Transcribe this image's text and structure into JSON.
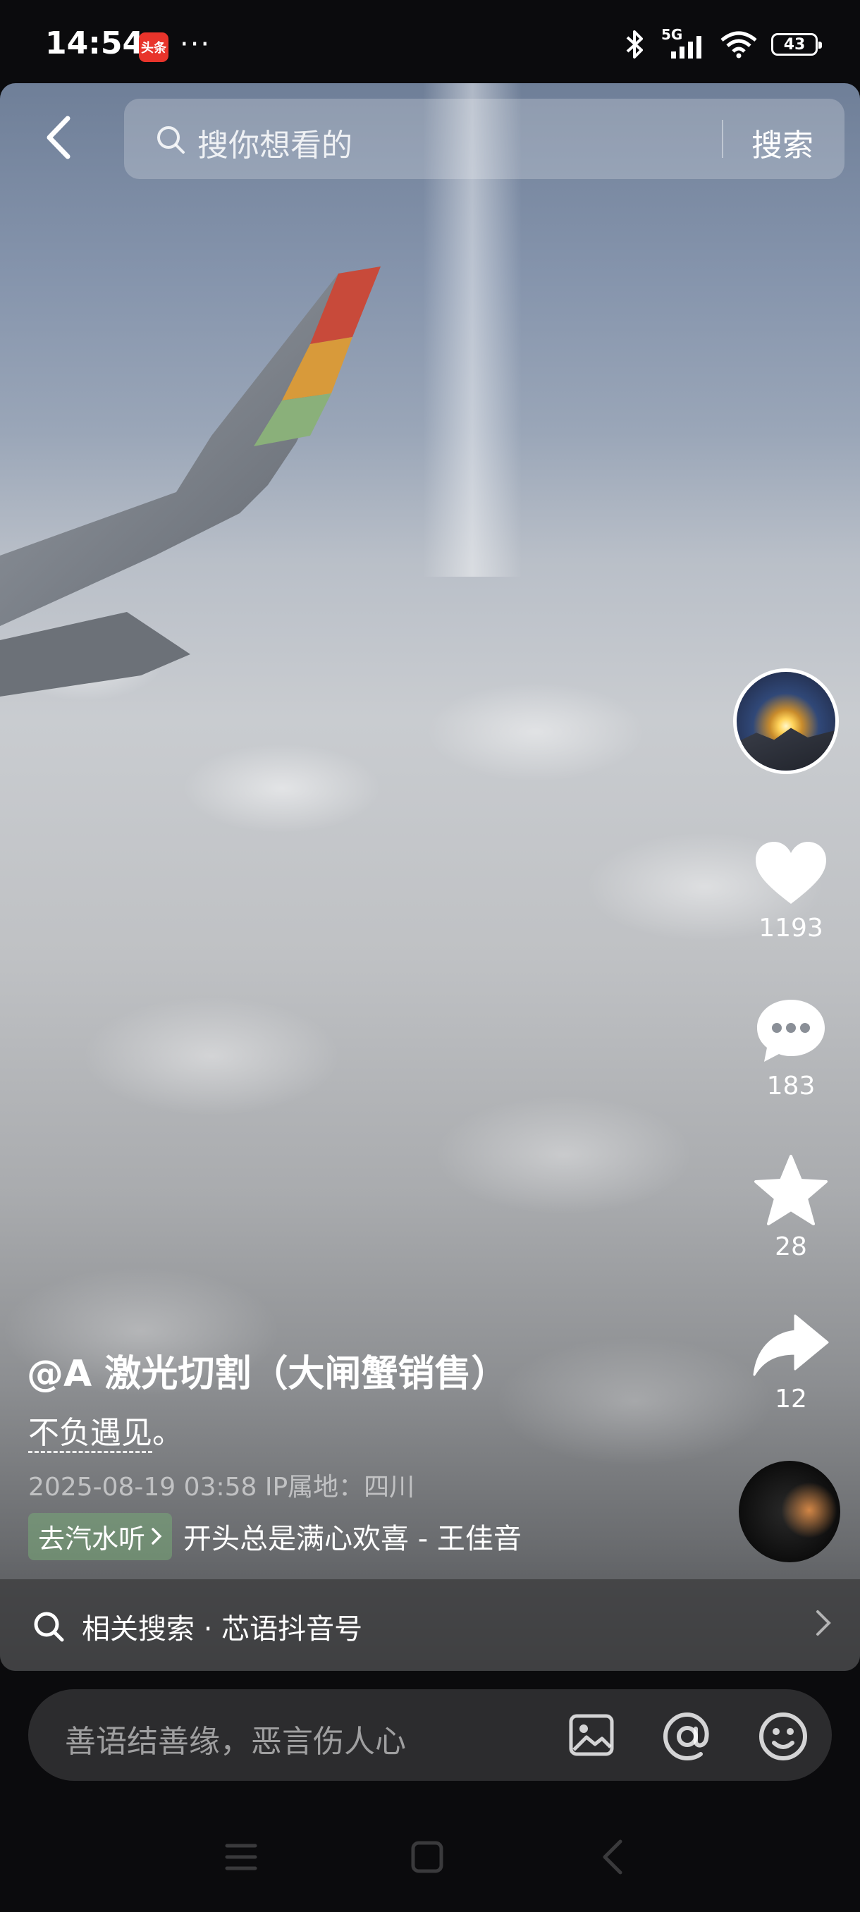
{
  "status_bar": {
    "time": "14:54",
    "app_badge": "头条",
    "more": "···",
    "network": "5G",
    "battery": "43"
  },
  "search": {
    "placeholder": "搜你想看的",
    "button": "搜索"
  },
  "actions": {
    "like_count": "1193",
    "comment_count": "183",
    "favorite_count": "28",
    "share_count": "12"
  },
  "post": {
    "author": "@A 激光切割（大闸蟹销售）",
    "description_link": "不负遇见",
    "description_tail": "。",
    "meta": "2025-08-19 03:58  IP属地：四川",
    "music_tag": "去汽水听",
    "music_name": "开头总是满心欢喜 - 王佳音"
  },
  "related": {
    "text": "相关搜索 · 芯语抖音号"
  },
  "comment": {
    "placeholder": "善语结善缘，恶言伤人心"
  },
  "icons": [
    "back-icon",
    "search-icon",
    "heart-icon",
    "comment-icon",
    "star-icon",
    "share-icon",
    "image-icon",
    "at-icon",
    "emoji-icon",
    "menu-icon",
    "home-icon",
    "nav-back-icon"
  ]
}
